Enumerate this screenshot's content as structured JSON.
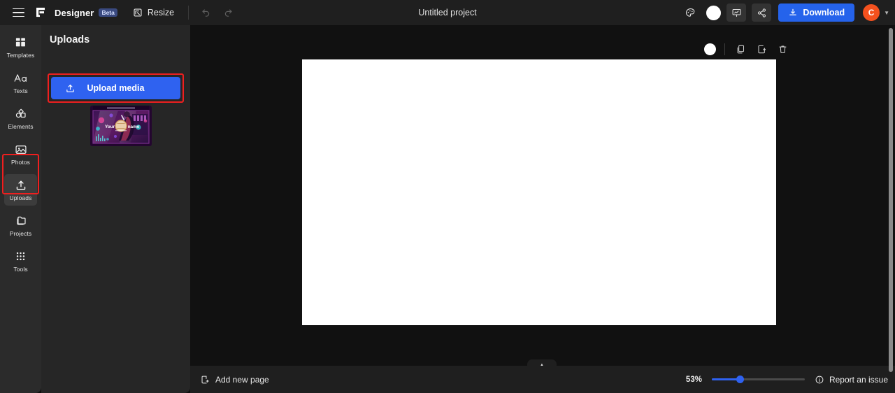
{
  "topbar": {
    "menu_icon": "hamburger-menu-icon",
    "logo_icon": "flipsnack-logo-icon",
    "brand": "Designer",
    "beta_badge": "Beta",
    "resize_label": "Resize",
    "resize_icon": "resize-icon",
    "undo_icon": "undo-arrow-icon",
    "redo_icon": "redo-arrow-icon",
    "project_title": "Untitled project",
    "palette_icon": "palette-icon",
    "color_swatch": "white-color-swatch",
    "present_icon": "present-icon",
    "share_icon": "share-icon",
    "download_label": "Download",
    "download_icon": "download-icon",
    "avatar_initial": "C",
    "avatar_caret": "chevron-down-icon",
    "download_color": "#2563eb",
    "avatar_color": "#f4511e"
  },
  "rail": {
    "items": [
      {
        "label": "Templates",
        "icon": "templates-grid-icon",
        "active": false
      },
      {
        "label": "Texts",
        "icon": "text-aa-icon",
        "active": false
      },
      {
        "label": "Elements",
        "icon": "elements-shapes-icon",
        "active": false
      },
      {
        "label": "Photos",
        "icon": "photos-image-icon",
        "active": false
      },
      {
        "label": "Uploads",
        "icon": "uploads-arrow-icon",
        "active": true
      },
      {
        "label": "Projects",
        "icon": "projects-folder-icon",
        "active": false
      },
      {
        "label": "Tools",
        "icon": "tools-dots-icon",
        "active": false
      }
    ],
    "highlight_color": "#ef1f1f"
  },
  "panel": {
    "title": "Uploads",
    "upload_button_label": "Upload media",
    "upload_button_icon": "upload-icon",
    "upload_button_color": "#2f62f0",
    "highlight_color": "#ef1f1f",
    "thumbnail_name": "uploaded-media-thumbnail",
    "thumbnail_text_left": "Your",
    "thumbnail_text_right": "name",
    "collapse_icon": "chevron-left-icon"
  },
  "canvas": {
    "toolbar": {
      "color_swatch": "page-color-swatch",
      "copy_icon": "copy-icon",
      "duplicate_icon": "duplicate-page-icon",
      "delete_icon": "trash-icon"
    },
    "page_background": "#ffffff",
    "expand_icon": "chevron-up-icon"
  },
  "bottombar": {
    "add_page_label": "Add new page",
    "add_page_icon": "add-page-icon",
    "zoom_value": "53%",
    "zoom_percent": 53,
    "slider_color": "#2f62f0",
    "report_label": "Report an issue",
    "report_icon": "info-circle-icon"
  }
}
